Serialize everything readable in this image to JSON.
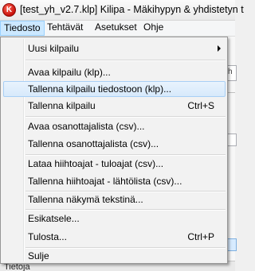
{
  "window": {
    "title": "[test_yh_v2.7.klp] Kilipa - Mäkihypyn & yhdistetyn t",
    "icon": "app-logo-icon",
    "icon_letter": "K"
  },
  "menubar": {
    "items": [
      "Tiedosto",
      "Tehtävät",
      "Asetukset",
      "Ohje"
    ]
  },
  "file_menu": {
    "items": [
      {
        "label": "Uusi kilpailu",
        "shortcut": ""
      },
      {
        "label": "Avaa kilpailu (klp)...",
        "shortcut": ""
      },
      {
        "label": "Tallenna kilpailu tiedostoon (klp)...",
        "shortcut": ""
      },
      {
        "label": "Tallenna kilpailu",
        "shortcut": "Ctrl+S"
      },
      {
        "label": "Avaa osanottajalista (csv)...",
        "shortcut": ""
      },
      {
        "label": "Tallenna osanottajalista (csv)...",
        "shortcut": ""
      },
      {
        "label": "Lataa hiihtoajat - tuloajat (csv)...",
        "shortcut": ""
      },
      {
        "label": "Tallenna hiihtoajat - lähtölista (csv)...",
        "shortcut": ""
      },
      {
        "label": "Tallenna näkymä tekstinä...",
        "shortcut": ""
      },
      {
        "label": "Esikatsele...",
        "shortcut": ""
      },
      {
        "label": "Tulosta...",
        "shortcut": "Ctrl+P"
      },
      {
        "label": "Sulje",
        "shortcut": ""
      }
    ]
  },
  "background": {
    "field_text": "h",
    "bottom_label": "Tietoja"
  }
}
